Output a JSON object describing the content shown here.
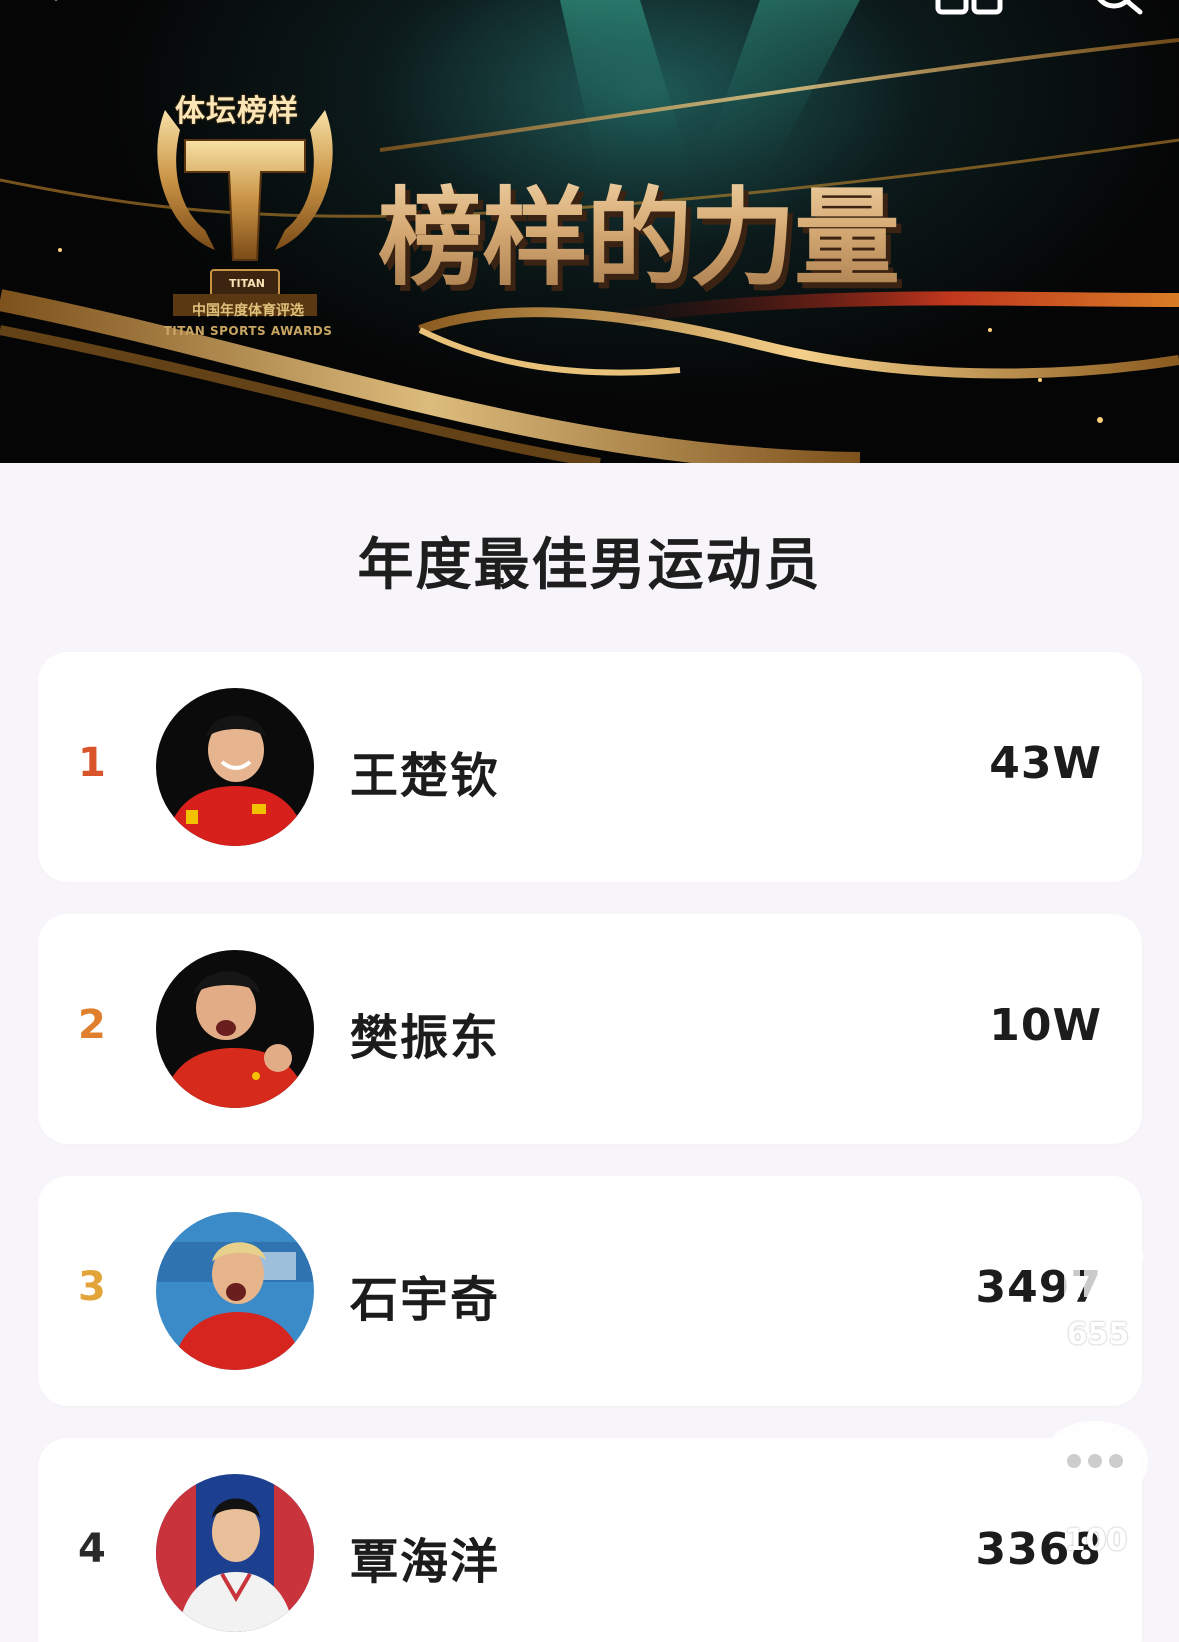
{
  "banner": {
    "trophy_title": "体坛榜样",
    "trophy_plate": "TITAN",
    "trophy_subtitle": "中国年度体育评选",
    "trophy_subtitle_en": "TITAN SPORTS AWARDS",
    "slogan": "榜样的力量",
    "accent_gold": "#d6aa74"
  },
  "section": {
    "title": "年度最佳男运动员"
  },
  "ranking": [
    {
      "rank": "1",
      "name": "王楚钦",
      "votes": "43W",
      "rank_color": "#d9542b",
      "jersey": "#d7201c",
      "bg": "#0b0b0b"
    },
    {
      "rank": "2",
      "name": "樊振东",
      "votes": "10W",
      "rank_color": "#e0802e",
      "jersey": "#d62a1c",
      "bg": "#0b0b0b"
    },
    {
      "rank": "3",
      "name": "石宇奇",
      "votes": "3497",
      "rank_color": "#e3a43a",
      "jersey": "#d6241e",
      "bg": "#3b8bc9"
    },
    {
      "rank": "4",
      "name": "覃海洋",
      "votes": "3368",
      "rank_color": "#2a2a2a",
      "jersey": "#f2f2f2",
      "bg": "#1d3f8f"
    }
  ],
  "actions": {
    "like_count": "655",
    "comment_count": "100",
    "like_icon": "thumbs-up-icon",
    "comment_icon": "chat-bubble-icon"
  }
}
